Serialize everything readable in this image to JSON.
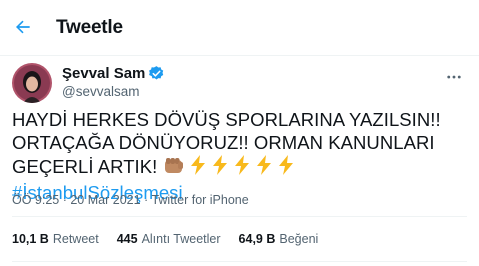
{
  "header": {
    "title": "Tweetle"
  },
  "tweet": {
    "display_name": "Şevval Sam",
    "handle": "@sevvalsam",
    "text_part1": "HAYDİ HERKES DÖVÜŞ SPORLARINA YAZILSIN!! ORTAÇAĞA DÖNÜYORUZ!! ORMAN KANUNLARI GEÇERLİ ARTIK! ",
    "hashtag": "#İstanbulSözleşmesi",
    "emoji_icons": [
      "oncoming-fist-icon",
      "high-voltage-icon",
      "high-voltage-icon",
      "high-voltage-icon",
      "high-voltage-icon",
      "high-voltage-icon"
    ],
    "time": "ÖÖ 9:25",
    "date": "20 Mar 2021",
    "source": "Twitter for iPhone"
  },
  "stats": {
    "retweets_num": "10,1 B",
    "retweets_label": "Retweet",
    "quotes_num": "445",
    "quotes_label": "Alıntı Tweetler",
    "likes_num": "64,9 B",
    "likes_label": "Beğeni"
  },
  "colors": {
    "accent": "#1d9bf0",
    "secondary_text": "#536471",
    "primary_text": "#0f1419",
    "verified": "#1d9bf0",
    "bolt": "#f8b91c",
    "fist": "#c08a62"
  }
}
